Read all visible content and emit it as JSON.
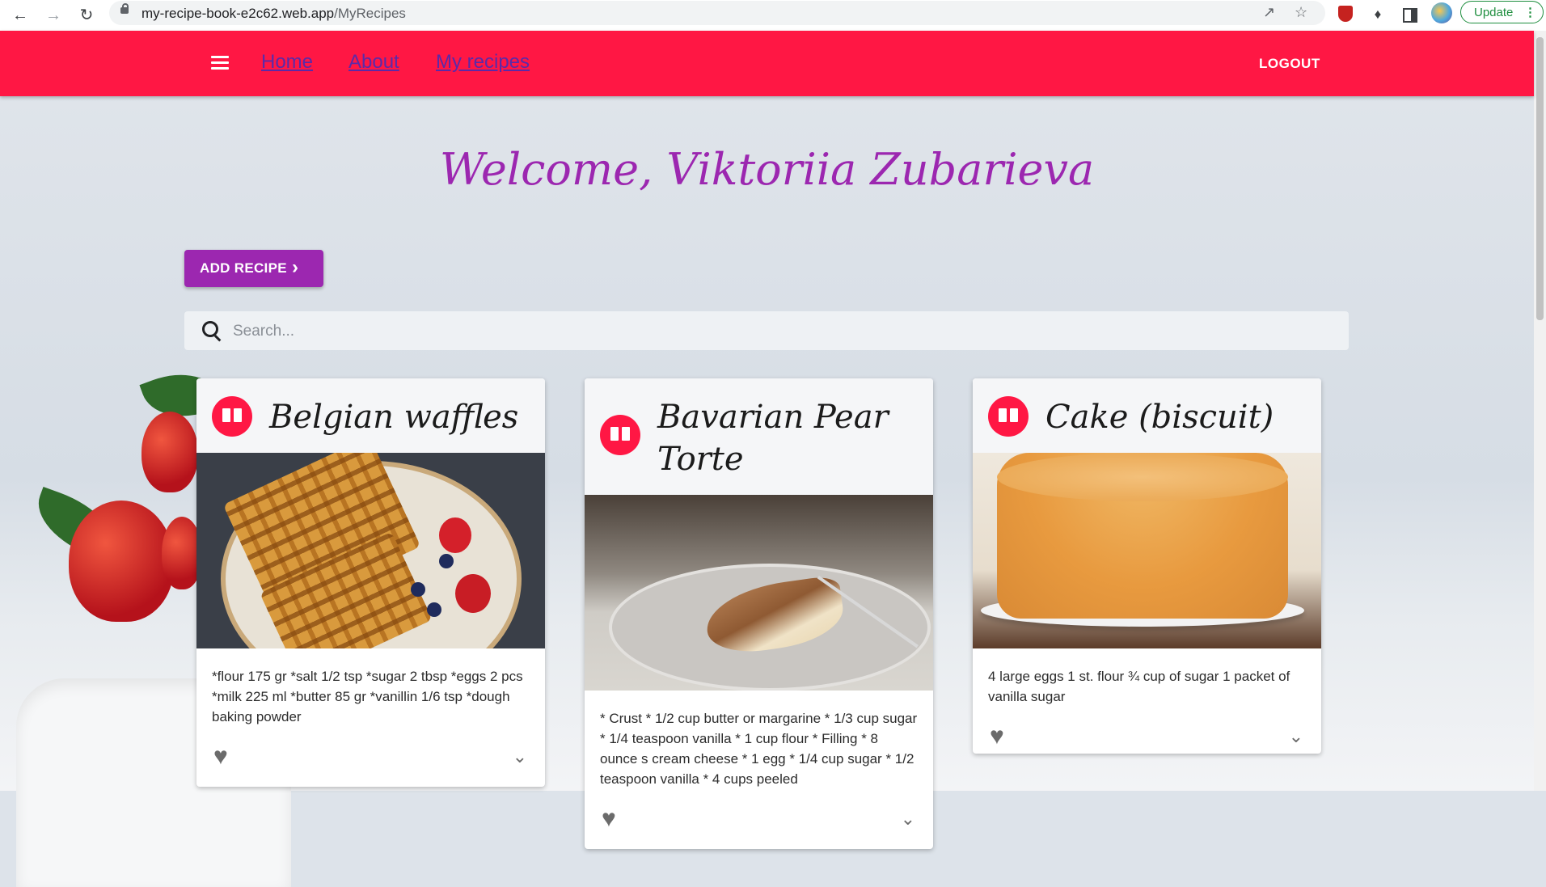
{
  "browser": {
    "url_host": "my-recipe-book-e2c62.web.app",
    "url_path": "/MyRecipes",
    "update_label": "Update"
  },
  "nav": {
    "links": [
      "Home",
      "About",
      "My recipes"
    ],
    "logout_label": "LOGOUT"
  },
  "page": {
    "welcome": "Welcome, Viktoriia Zubarieva",
    "add_recipe_label": "ADD RECIPE",
    "search_placeholder": "Search..."
  },
  "recipes": [
    {
      "title": "Belgian waffles",
      "description": "*flour 175 gr *salt 1/2 tsp *sugar 2 tbsp *eggs 2 pcs *milk 225 ml *butter 85 gr *vanillin 1/6 tsp *dough baking powder"
    },
    {
      "title": "Bavarian Pear Torte",
      "description": "* Crust * 1/2 cup butter or margarine * 1/3 cup sugar * 1/4 teaspoon vanilla * 1 cup flour * Filling * 8 ounce s cream cheese * 1 egg * 1/4 cup sugar * 1/2 teaspoon vanilla * 4 cups peeled"
    },
    {
      "title": "Cake (biscuit)",
      "description": "4 large eggs 1 st. flour ¾ cup of sugar 1 packet of vanilla sugar"
    }
  ],
  "colors": {
    "appbar": "#ff1744",
    "accent": "#9c27b0",
    "nav_link": "#5b2aa8"
  },
  "icons": {
    "menu": "menu-icon",
    "search": "search-icon",
    "recipe_avatar": "book-icon",
    "favorite": "heart-icon",
    "expand": "chevron-down-icon",
    "add_arrow": "chevron-right-icon"
  }
}
